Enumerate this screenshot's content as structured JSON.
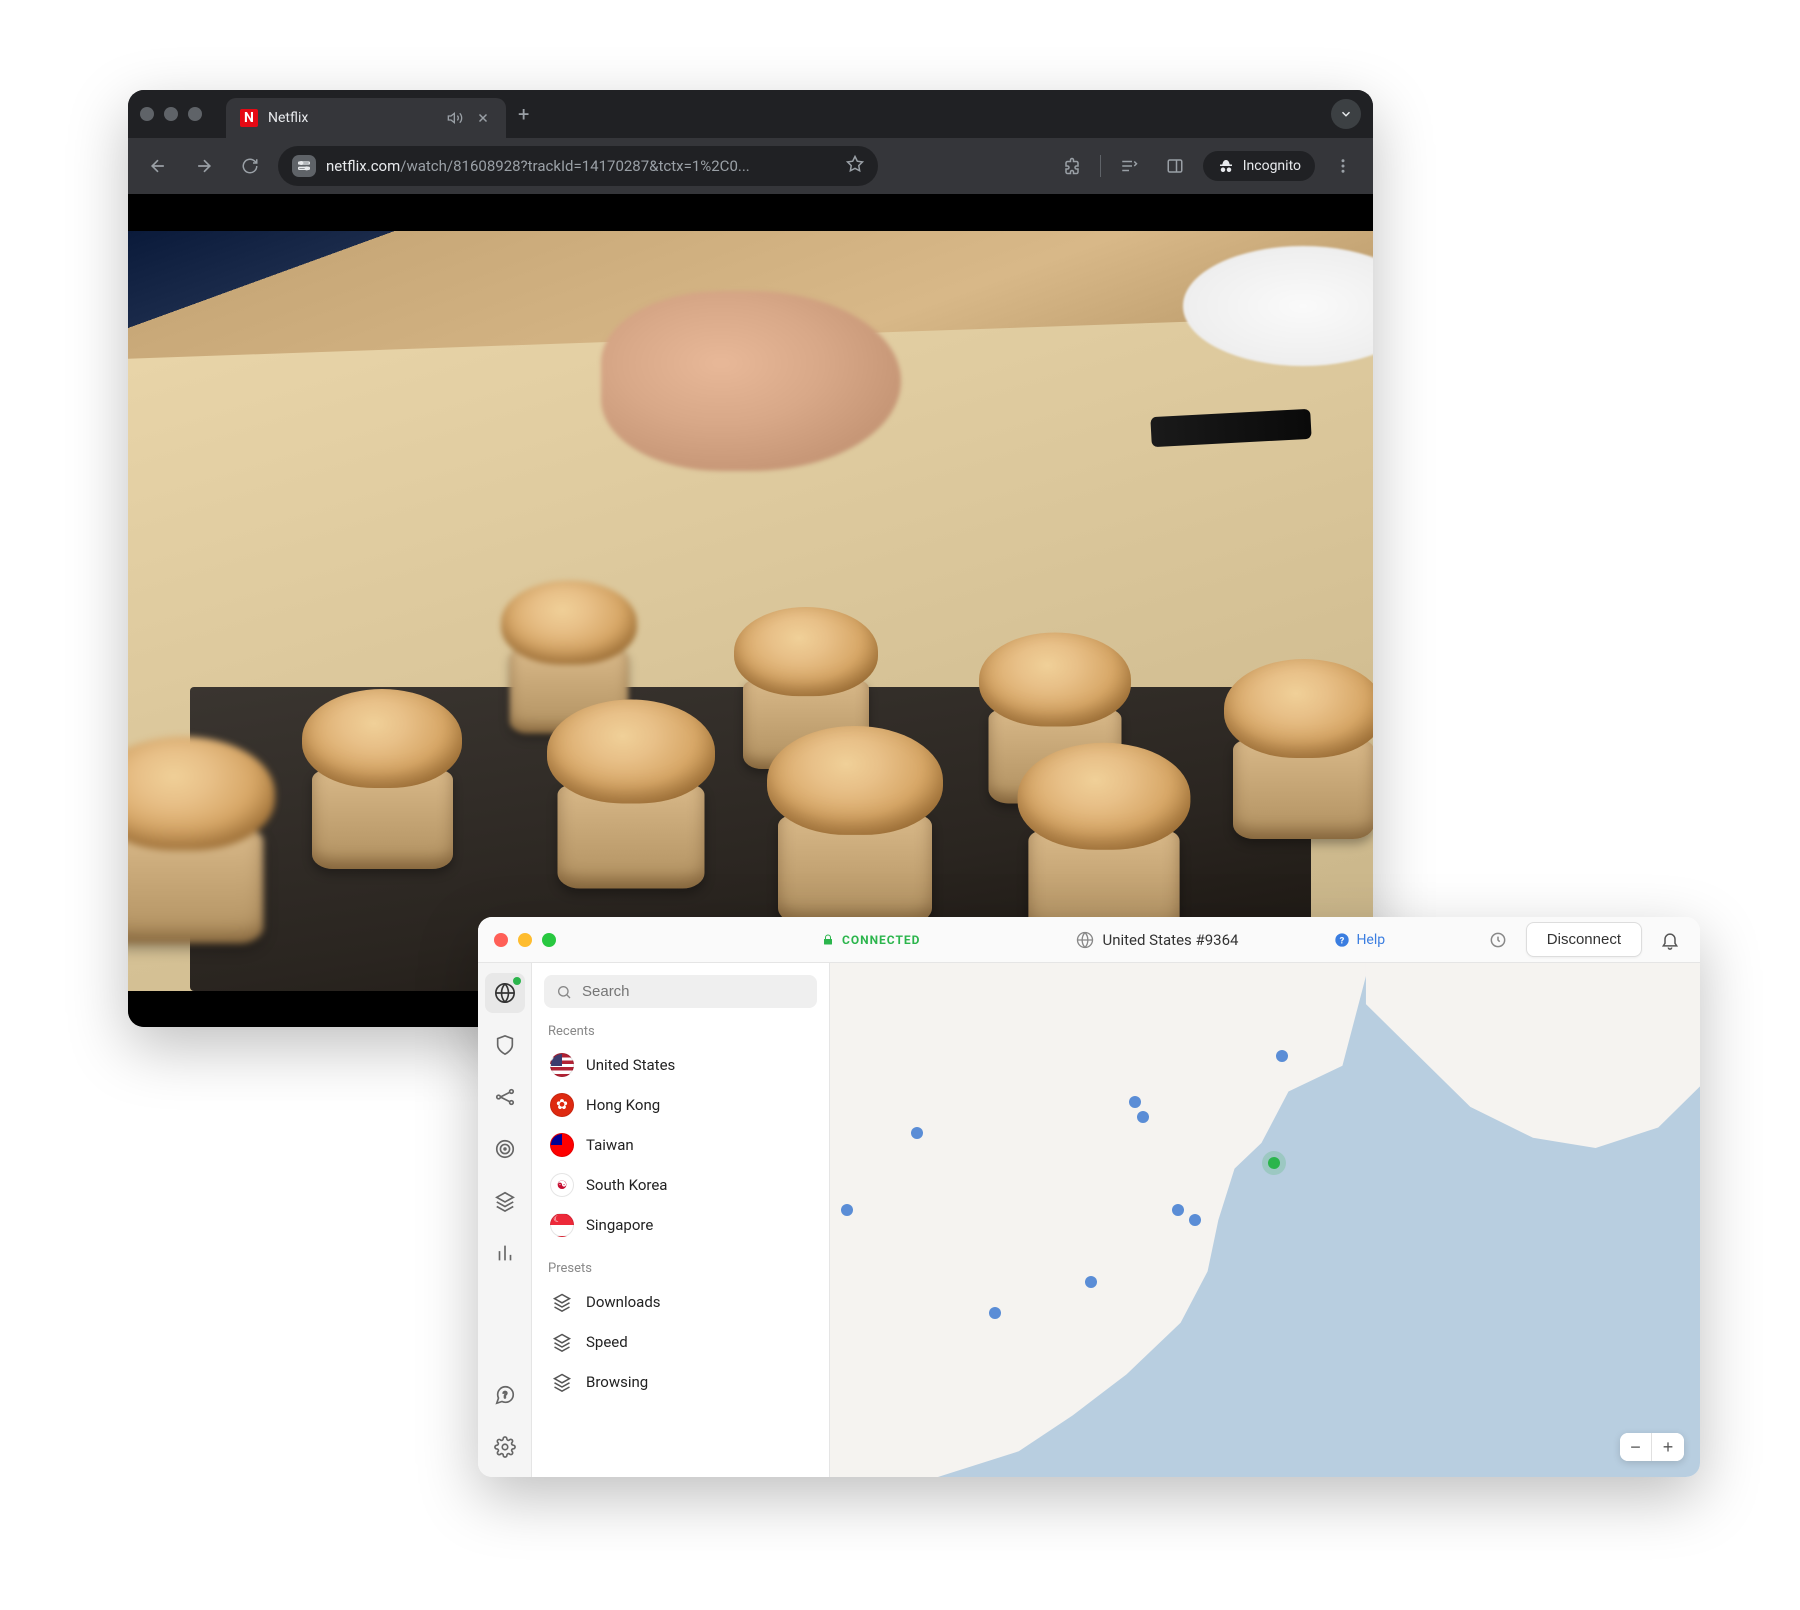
{
  "browser": {
    "tab_title": "Netflix",
    "tab_favicon_letter": "N",
    "url_domain": "netflix.com",
    "url_path": "/watch/81608928?trackId=14170287&tctx=1%2C0...",
    "incognito_label": "Incognito"
  },
  "vpn": {
    "status": "CONNECTED",
    "server": "United States #9364",
    "help_label": "Help",
    "disconnect_label": "Disconnect",
    "search_placeholder": "Search",
    "recents_header": "Recents",
    "presets_header": "Presets",
    "recents": [
      {
        "label": "United States",
        "flag": "us"
      },
      {
        "label": "Hong Kong",
        "flag": "hk"
      },
      {
        "label": "Taiwan",
        "flag": "tw"
      },
      {
        "label": "South Korea",
        "flag": "kr"
      },
      {
        "label": "Singapore",
        "flag": "sg"
      }
    ],
    "presets": [
      {
        "label": "Downloads"
      },
      {
        "label": "Speed"
      },
      {
        "label": "Browsing"
      }
    ]
  }
}
